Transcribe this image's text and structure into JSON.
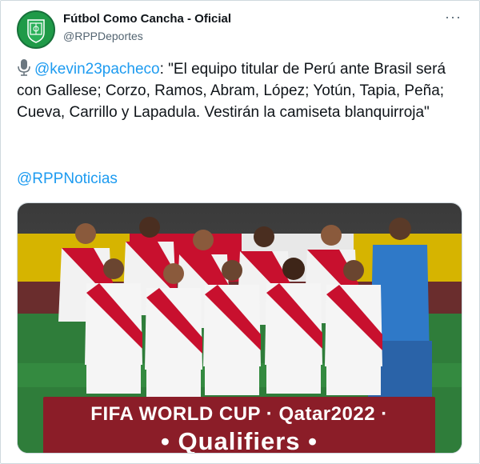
{
  "account": {
    "name": "Fútbol Como Cancha - Oficial",
    "handle": "@RPPDeportes"
  },
  "tweet": {
    "mention": "@kevin23pacheco",
    "body": ": \"El equipo titular de Perú ante Brasil será con Gallese; Corzo, Ramos, Abram, López; Yotún, Tapia, Peña; Cueva, Carrillo y Lapadula. Vestirán la camiseta blanquirroja\"",
    "link": "@RPPNoticias"
  },
  "photo": {
    "banner_line1": "FIFA WORLD CUP · Qatar2022 ·",
    "banner_line2": "• Qualifiers •"
  },
  "icons": {
    "more": "more-icon",
    "mic": "microphone-icon",
    "avatar": "green-crest-avatar"
  },
  "colors": {
    "link": "#1d9bf0",
    "avatar_bg": "#1f9a48",
    "banner_bg": "#8b1d28",
    "jersey_red": "#c8102e",
    "keeper_blue": "#2f79c8",
    "pitch": "#2f7d3a"
  }
}
